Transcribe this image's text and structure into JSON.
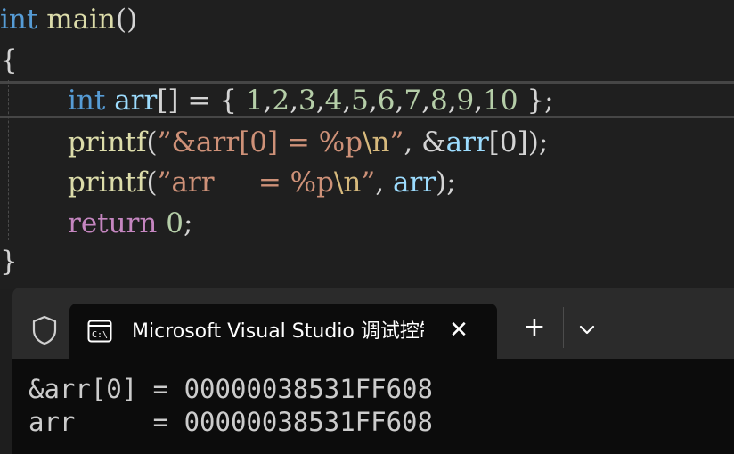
{
  "editor": {
    "line1": {
      "kw": "int",
      "fn": "main",
      "paren": "()"
    },
    "line2": "{",
    "line3": {
      "kw": "int",
      "var": "arr",
      "brackets": "[]",
      "eq": " = ",
      "lbrace": "{ ",
      "nums": [
        "1",
        "2",
        "3",
        "4",
        "5",
        "6",
        "7",
        "8",
        "9",
        "10"
      ],
      "tail": " };"
    },
    "line4": {
      "fn": "printf",
      "open": "(",
      "str1": "”&arr[0] = %p",
      "esc": "\\n",
      "str2": "”",
      "rest1": ", ",
      "amp": "&",
      "var": "arr",
      "idx": "[0]",
      "close": ");"
    },
    "line5": {
      "fn": "printf",
      "open": "(",
      "str1": "”arr     = %p",
      "esc": "\\n",
      "str2": "”",
      "rest1": ", ",
      "var": "arr",
      "close": ");"
    },
    "line6": {
      "kw": "return",
      "num": "0",
      "semi": ";"
    },
    "line7": "}"
  },
  "terminal": {
    "tab_title": "Microsoft Visual Studio 调试控制台",
    "tab_icon": "console-app-icon",
    "close_glyph": "✕",
    "new_tab_glyph": "+",
    "output": [
      "&arr[0] = 00000038531FF608",
      "arr     = 00000038531FF608"
    ]
  }
}
